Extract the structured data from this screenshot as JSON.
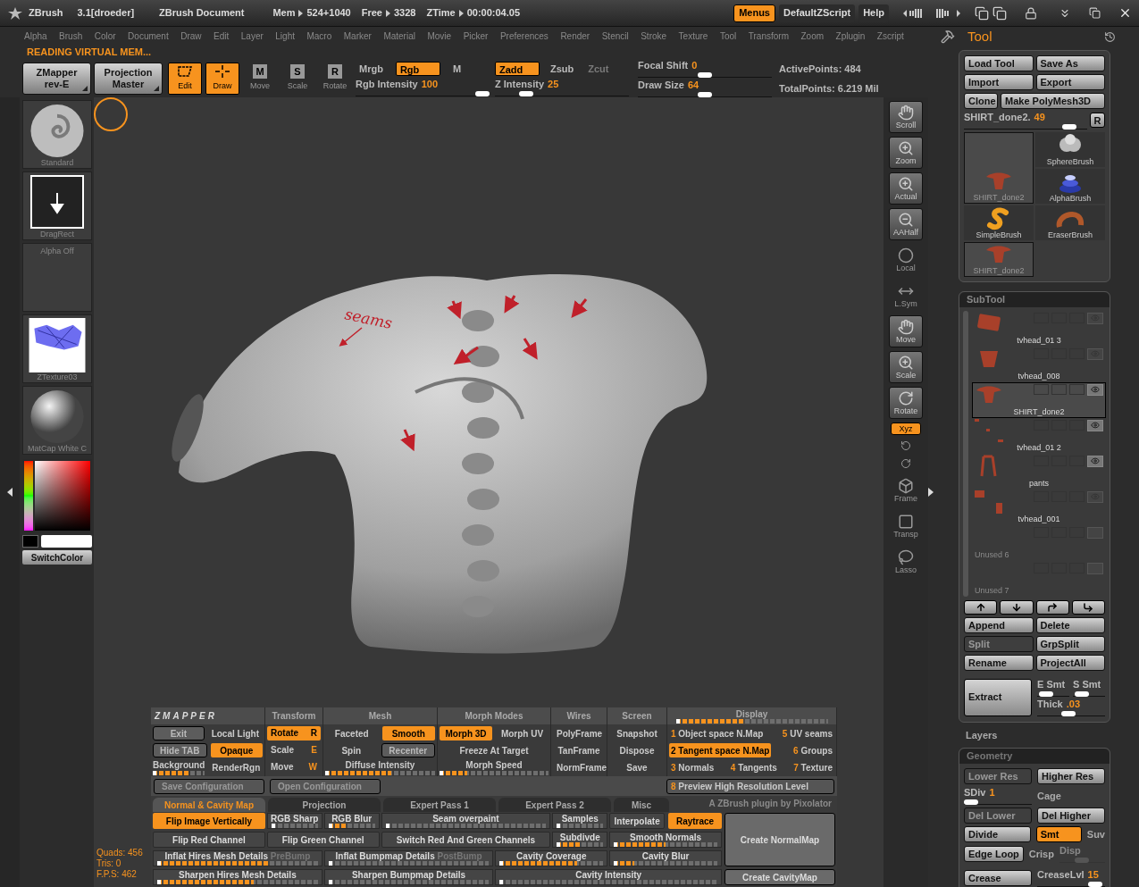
{
  "title_bar": {
    "app": "ZBrush",
    "version": "3.1[droeder]",
    "document": "ZBrush Document",
    "stats": [
      {
        "label": "Mem",
        "value": "524+1040"
      },
      {
        "label": "Free",
        "value": "3328"
      },
      {
        "label": "ZTime",
        "value": "00:00:04.05"
      }
    ],
    "buttons": [
      {
        "label": "Menus",
        "selected": true
      },
      {
        "label": "DefaultZScript",
        "selected": false
      },
      {
        "label": "Help",
        "selected": false
      }
    ]
  },
  "menu_bar": [
    "Alpha",
    "Brush",
    "Color",
    "Document",
    "Draw",
    "Edit",
    "Layer",
    "Light",
    "Macro",
    "Marker",
    "Material",
    "Movie",
    "Picker",
    "Preferences",
    "Render",
    "Stencil",
    "Stroke",
    "Texture",
    "Tool",
    "Transform",
    "Zoom",
    "Zplugin",
    "Zscript"
  ],
  "status": "READING VIRTUAL MEM...",
  "toolbar": {
    "plugins": [
      {
        "title": "ZMapper",
        "subtitle": "rev-E"
      },
      {
        "title": "Projection",
        "subtitle": "Master"
      }
    ],
    "modes": [
      {
        "label": "Edit",
        "kind": "edit",
        "on": true
      },
      {
        "label": "Draw",
        "kind": "draw",
        "on": true
      },
      {
        "label": "Move",
        "kind": "letter",
        "letter": "M",
        "on": false
      },
      {
        "label": "Scale",
        "kind": "letter",
        "letter": "S",
        "on": false
      },
      {
        "label": "Rotate",
        "kind": "letter",
        "letter": "R",
        "on": false
      }
    ],
    "rgb_modes": [
      {
        "label": "Mrgb",
        "on": false
      },
      {
        "label": "Rgb",
        "on": true
      },
      {
        "label": "M",
        "on": false
      }
    ],
    "rgb_intensity": {
      "label": "Rgb Intensity",
      "value": "100",
      "level": 1
    },
    "z_modes": [
      {
        "label": "Zadd",
        "on": true,
        "disabled": false
      },
      {
        "label": "Zsub",
        "on": false,
        "disabled": false
      },
      {
        "label": "Zcut",
        "on": false,
        "disabled": true
      }
    ],
    "z_intensity": {
      "label": "Z Intensity",
      "value": "25",
      "level": 0.2
    },
    "focal_shift": {
      "label": "Focal Shift",
      "value": "0",
      "level": 0.5
    },
    "draw_size": {
      "label": "Draw Size",
      "value": "64",
      "level": 0.5
    },
    "points": [
      "ActivePoints: 484",
      "TotalPoints: 6.219 Mil"
    ]
  },
  "left_tray": {
    "tiles": [
      {
        "label": "Standard",
        "kind": "swirl"
      },
      {
        "label": "DragRect",
        "kind": "dragrect"
      },
      {
        "label": "Alpha Off",
        "kind": "empty"
      },
      {
        "label": "ZTexture03",
        "kind": "texture"
      },
      {
        "label": "MatCap White C",
        "kind": "sphere"
      }
    ],
    "switch_color": "SwitchColor"
  },
  "canvas": {
    "annotation": "seams",
    "stats": [
      "Quads: 456",
      "Tris: 0",
      "F.P.S: 462"
    ]
  },
  "shelf": [
    {
      "label": "Scroll",
      "kind": "framed",
      "on": false
    },
    {
      "label": "Zoom",
      "kind": "framed",
      "on": false
    },
    {
      "label": "Actual",
      "kind": "framed",
      "on": false
    },
    {
      "label": "AAHalf",
      "kind": "framed",
      "on": false
    },
    {
      "label": "Local",
      "kind": "plain",
      "on": false
    },
    {
      "label": "L.Sym",
      "kind": "plain",
      "on": false
    },
    {
      "label": "Move",
      "kind": "framed",
      "on": false
    },
    {
      "label": "Scale",
      "kind": "framed",
      "on": false
    },
    {
      "label": "Rotate",
      "kind": "framed",
      "on": false
    },
    {
      "label": "Xyz",
      "kind": "text",
      "on": true
    },
    {
      "kind": "icon",
      "on": false
    },
    {
      "kind": "icon",
      "on": false
    },
    {
      "label": "Frame",
      "kind": "plain",
      "on": false
    },
    {
      "label": "Transp",
      "kind": "plain",
      "on": false
    },
    {
      "label": "Lasso",
      "kind": "plain",
      "on": false
    }
  ],
  "zmapper": {
    "sections": [
      {
        "header": "ZMAPPER",
        "rows": [
          [
            {
              "kind": "button",
              "label": "Exit"
            },
            {
              "kind": "toggle",
              "label": "Local Light",
              "on": false
            }
          ],
          [
            {
              "kind": "button",
              "label": "Hide TAB"
            },
            {
              "kind": "toggle",
              "label": "Opaque",
              "on": true
            }
          ],
          [
            {
              "kind": "slider",
              "label": "Background",
              "level": 0.7
            },
            {
              "kind": "toggle",
              "label": "RenderRgn",
              "on": false
            }
          ]
        ]
      },
      {
        "header": "Transform",
        "rows": [
          [
            {
              "kind": "key",
              "label": "Rotate",
              "key": "R",
              "on": true
            }
          ],
          [
            {
              "kind": "key",
              "label": "Scale",
              "key": "E",
              "on": false
            }
          ],
          [
            {
              "kind": "key",
              "label": "Move",
              "key": "W",
              "on": false
            }
          ]
        ]
      },
      {
        "header": "Mesh",
        "rows": [
          [
            {
              "kind": "toggle",
              "label": "Faceted",
              "on": false
            },
            {
              "kind": "toggle",
              "label": "Smooth",
              "on": true
            }
          ],
          [
            {
              "kind": "toggle",
              "label": "Spin",
              "on": false
            },
            {
              "kind": "button",
              "label": "Recenter"
            }
          ],
          [
            {
              "kind": "slider",
              "label": "Diffuse Intensity",
              "level": 0.6
            }
          ]
        ]
      },
      {
        "header": "Morph Modes",
        "rows": [
          [
            {
              "kind": "toggle",
              "label": "Morph 3D",
              "on": true
            },
            {
              "kind": "toggle",
              "label": "Morph UV",
              "on": false
            }
          ],
          [
            {
              "kind": "toggle",
              "label": "Freeze At Target",
              "on": false
            }
          ],
          [
            {
              "kind": "slider",
              "label": "Morph Speed",
              "level": 0.25
            }
          ]
        ]
      },
      {
        "header": "Wires",
        "rows": [
          [
            {
              "kind": "toggle",
              "label": "PolyFrame",
              "on": false
            }
          ],
          [
            {
              "kind": "toggle",
              "label": "TanFrame",
              "on": false
            }
          ],
          [
            {
              "kind": "toggle",
              "label": "NormFrame",
              "on": false
            }
          ]
        ]
      },
      {
        "header": "Screen",
        "rows": [
          [
            {
              "kind": "toggle",
              "label": "Snapshot",
              "on": false
            }
          ],
          [
            {
              "kind": "toggle",
              "label": "Dispose",
              "on": false
            }
          ],
          [
            {
              "kind": "toggle",
              "label": "Save",
              "on": false
            }
          ]
        ]
      },
      {
        "header": "Display",
        "level": 0.45,
        "items": [
          {
            "kind": "numbered",
            "num": "1",
            "label": "Object space N.Map",
            "on": false
          },
          {
            "kind": "numbered",
            "num": "5",
            "label": "UV seams",
            "on": false
          },
          {
            "kind": "numbered",
            "num": "2",
            "label": "Tangent space N.Map",
            "on": true
          },
          {
            "kind": "numbered",
            "num": "6",
            "label": "Groups",
            "on": false
          },
          {
            "kind": "numbered",
            "num": "3",
            "label": "Normals",
            "on": false
          },
          {
            "kind": "numbered",
            "num": "4",
            "label": "Tangents",
            "on": false
          },
          {
            "kind": "numbered",
            "num": "7",
            "label": "Texture",
            "on": false
          }
        ]
      }
    ],
    "config_buttons": [
      "Save Configuration",
      "Open Configuration"
    ],
    "preview": {
      "num": "8",
      "label": "Preview High Resolution Level"
    },
    "tabs": [
      {
        "label": "Normal & Cavity Map",
        "selected": true
      },
      {
        "label": "Projection",
        "selected": false
      },
      {
        "label": "Expert Pass 1",
        "selected": false
      },
      {
        "label": "Expert Pass 2",
        "selected": false
      },
      {
        "label": "Misc",
        "selected": false
      }
    ],
    "credit": "A ZBrush plugin by Pixolator",
    "options": [
      [
        {
          "kind": "toggle",
          "label": "Flip Image Vertically",
          "on": true
        },
        {
          "kind": "slider",
          "label": "RGB Sharp",
          "level": 0
        },
        {
          "kind": "slider",
          "label": "RGB Blur",
          "level": 0.4
        },
        {
          "kind": "slider",
          "label": "Seam overpaint",
          "level": 0
        },
        {
          "kind": "slider",
          "label": "Samples",
          "level": 0
        },
        {
          "kind": "choice",
          "options": [
            {
              "label": "Interpolate",
              "selected": false
            },
            {
              "label": "Raytrace",
              "selected": true
            }
          ]
        }
      ],
      [
        {
          "kind": "toggle",
          "label": "Flip Red Channel",
          "on": false
        },
        {
          "kind": "toggle",
          "label": "Flip Green Channel",
          "on": false
        },
        {
          "kind": "toggle",
          "label": "Switch Red And Green Channels",
          "on": false
        },
        {
          "kind": "slider",
          "label": "Subdivde",
          "level": 0.5
        },
        {
          "kind": "slider",
          "label": "Smooth Normals",
          "level": 0.5
        }
      ],
      [
        {
          "kind": "slider",
          "label": "Inflat Hires Mesh Details",
          "suffix": "PreBump",
          "level": 0.7
        },
        {
          "kind": "slider",
          "label": "Inflat Bumpmap Details",
          "suffix": "PostBump",
          "level": 0
        },
        {
          "kind": "slider",
          "label": "Cavity Coverage",
          "level": 0.75
        },
        {
          "kind": "slider",
          "label": "Cavity Blur",
          "level": 0.2
        }
      ],
      [
        {
          "kind": "slider",
          "label": "Sharpen Hires Mesh Details",
          "level": 0.6
        },
        {
          "kind": "slider",
          "label": "Sharpen Bumpmap Details",
          "level": 0
        },
        {
          "kind": "slider",
          "label": "Cavity Intensity",
          "level": 0
        }
      ]
    ],
    "create_buttons": [
      "Create NormalMap",
      "Create CavityMap"
    ]
  },
  "tool_panel": {
    "title": "Tool",
    "buttons": [
      [
        {
          "label": "Load Tool",
          "disabled": false
        },
        {
          "label": "Save As",
          "disabled": false
        }
      ],
      [
        {
          "label": "Import",
          "disabled": false
        },
        {
          "label": "Export",
          "disabled": false
        }
      ],
      [
        {
          "label": "Clone",
          "disabled": false
        },
        {
          "label": "Make PolyMesh3D",
          "disabled": false
        }
      ]
    ],
    "tool_slider": {
      "label": "SHIRT_done2.",
      "value": "49",
      "level": 0.9
    },
    "reset": "R",
    "current_tool": {
      "label": "SHIRT_done2",
      "kind": "shirt",
      "selected": true
    },
    "brushes": [
      {
        "label": "SphereBrush",
        "kind": "sphere",
        "selected": false
      },
      {
        "label": "AlphaBrush",
        "kind": "alpha",
        "selected": false
      },
      {
        "label": "SimpleBrush",
        "kind": "simple",
        "selected": false
      },
      {
        "label": "EraserBrush",
        "kind": "eraser",
        "selected": false
      },
      {
        "label": "SHIRT_done2",
        "kind": "shirt",
        "selected": true
      }
    ]
  },
  "subtool": {
    "title": "SubTool",
    "items": [
      {
        "label": "tvhead_01 3",
        "kind": "block",
        "selected": false,
        "visible": false,
        "disabled": false
      },
      {
        "label": "tvhead_008",
        "kind": "cup",
        "selected": false,
        "visible": false,
        "disabled": false
      },
      {
        "label": "SHIRT_done2",
        "kind": "shirt",
        "selected": true,
        "visible": true,
        "disabled": false
      },
      {
        "label": "tvhead_01 2",
        "kind": "bits",
        "selected": false,
        "visible": true,
        "disabled": false
      },
      {
        "label": "pants",
        "kind": "pants",
        "selected": false,
        "visible": true,
        "disabled": false
      },
      {
        "label": "tvhead_001",
        "kind": "pieces",
        "selected": false,
        "visible": false,
        "disabled": false
      },
      {
        "label": "Unused 6",
        "kind": "none",
        "selected": false,
        "visible": false,
        "disabled": true
      },
      {
        "label": "Unused 7",
        "kind": "none",
        "selected": false,
        "visible": false,
        "disabled": true
      }
    ],
    "rows": [
      [
        {
          "label": "Append",
          "disabled": false
        },
        {
          "label": "Delete",
          "disabled": false
        }
      ],
      [
        {
          "label": "Split",
          "disabled": true
        },
        {
          "label": "GrpSplit",
          "disabled": false
        }
      ],
      [
        {
          "label": "Rename",
          "disabled": false
        },
        {
          "label": "ProjectAll",
          "disabled": false
        }
      ]
    ],
    "extract": "Extract",
    "smooth_sliders": [
      {
        "label": "E Smt",
        "level": 0.1
      },
      {
        "label": "S Smt",
        "level": 0.1
      }
    ],
    "thick": {
      "label": "Thick",
      "value": ".03",
      "level": 0.45
    }
  },
  "layers": "Layers",
  "geometry": {
    "title": "Geometry",
    "items": [
      {
        "kind": "button",
        "label": "Lower Res",
        "disabled": true
      },
      {
        "kind": "button",
        "label": "Higher Res",
        "disabled": false
      },
      {
        "kind": "slider",
        "label": "SDiv",
        "value": "1",
        "level": 0
      },
      {
        "kind": "label",
        "label": "Cage"
      },
      {
        "kind": "button",
        "label": "Del Lower",
        "disabled": true
      },
      {
        "kind": "button",
        "label": "Del Higher",
        "disabled": false
      },
      {
        "kind": "button",
        "label": "Divide",
        "disabled": false
      },
      {
        "kind": "toggle",
        "label": "Smt",
        "on": true
      },
      {
        "kind": "label",
        "label": "Suv"
      },
      {
        "kind": "button",
        "label": "Edge Loop",
        "disabled": false
      },
      {
        "kind": "label",
        "label": "Crisp"
      },
      {
        "kind": "slider",
        "label": "Disp",
        "level": 0.5,
        "disabled": true
      },
      {
        "kind": "button",
        "label": "Crease",
        "disabled": false
      },
      {
        "kind": "slider",
        "label": "CreaseLvl",
        "value": "15",
        "level": 0.95
      }
    ]
  }
}
